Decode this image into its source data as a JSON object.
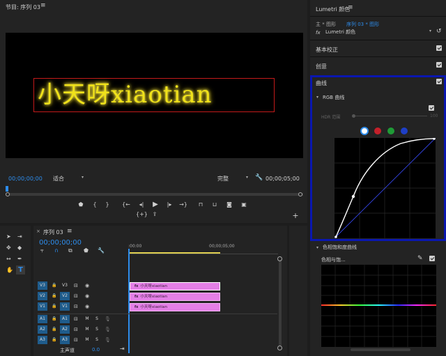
{
  "program_monitor": {
    "title": "节目: 序列 03",
    "menu_icon": "hamburger-icon",
    "title_text": "小天呀xiaotian",
    "timecode_current": "00;00;00;00",
    "fit_label": "适合",
    "quality_label": "完整",
    "timecode_end": "00;00;05;00"
  },
  "lumetri": {
    "title": "Lumetri 颜色",
    "breadcrumb_master": "主 * 图形",
    "breadcrumb_sequence": "序列 03 * 图形",
    "fx_label": "fx",
    "effect_name": "Lumetri 颜色",
    "sections": {
      "basic": "基本校正",
      "creative": "创意",
      "curves": "曲线",
      "rgb_curves": "RGB 曲线",
      "hdr_range": "HDR 范围",
      "hdr_value": "100",
      "hue_sat": "色相饱和度曲线",
      "hue_vs_sat": "色相与饱..."
    },
    "channel_colors": [
      "#ffffff",
      "#c4202a",
      "#1f9b36",
      "#1e3fc6"
    ],
    "highlight_color": "#0a17b0"
  },
  "timeline": {
    "sequence_name": "序列 03",
    "timecode": "00;00;00;00",
    "ruler": [
      ":00:00",
      "00;00;05;00"
    ],
    "video_tracks": [
      {
        "source": "V3",
        "target": "V3"
      },
      {
        "source": "V2",
        "target": "V2"
      },
      {
        "source": "V1",
        "target": "V1"
      }
    ],
    "audio_tracks": [
      {
        "source": "A1",
        "target": "A1",
        "m": "M",
        "s": "S"
      },
      {
        "source": "A2",
        "target": "A2",
        "m": "M",
        "s": "S"
      },
      {
        "source": "A3",
        "target": "A3",
        "m": "M",
        "s": "S"
      }
    ],
    "master_label": "主声道",
    "master_value": "0.0",
    "clips": [
      {
        "fx": "fx",
        "name": "小天呀xiaotian"
      },
      {
        "fx": "fx",
        "name": "小天呀xiaotian"
      },
      {
        "fx": "fx",
        "name": "小天呀xiaotian"
      }
    ]
  }
}
